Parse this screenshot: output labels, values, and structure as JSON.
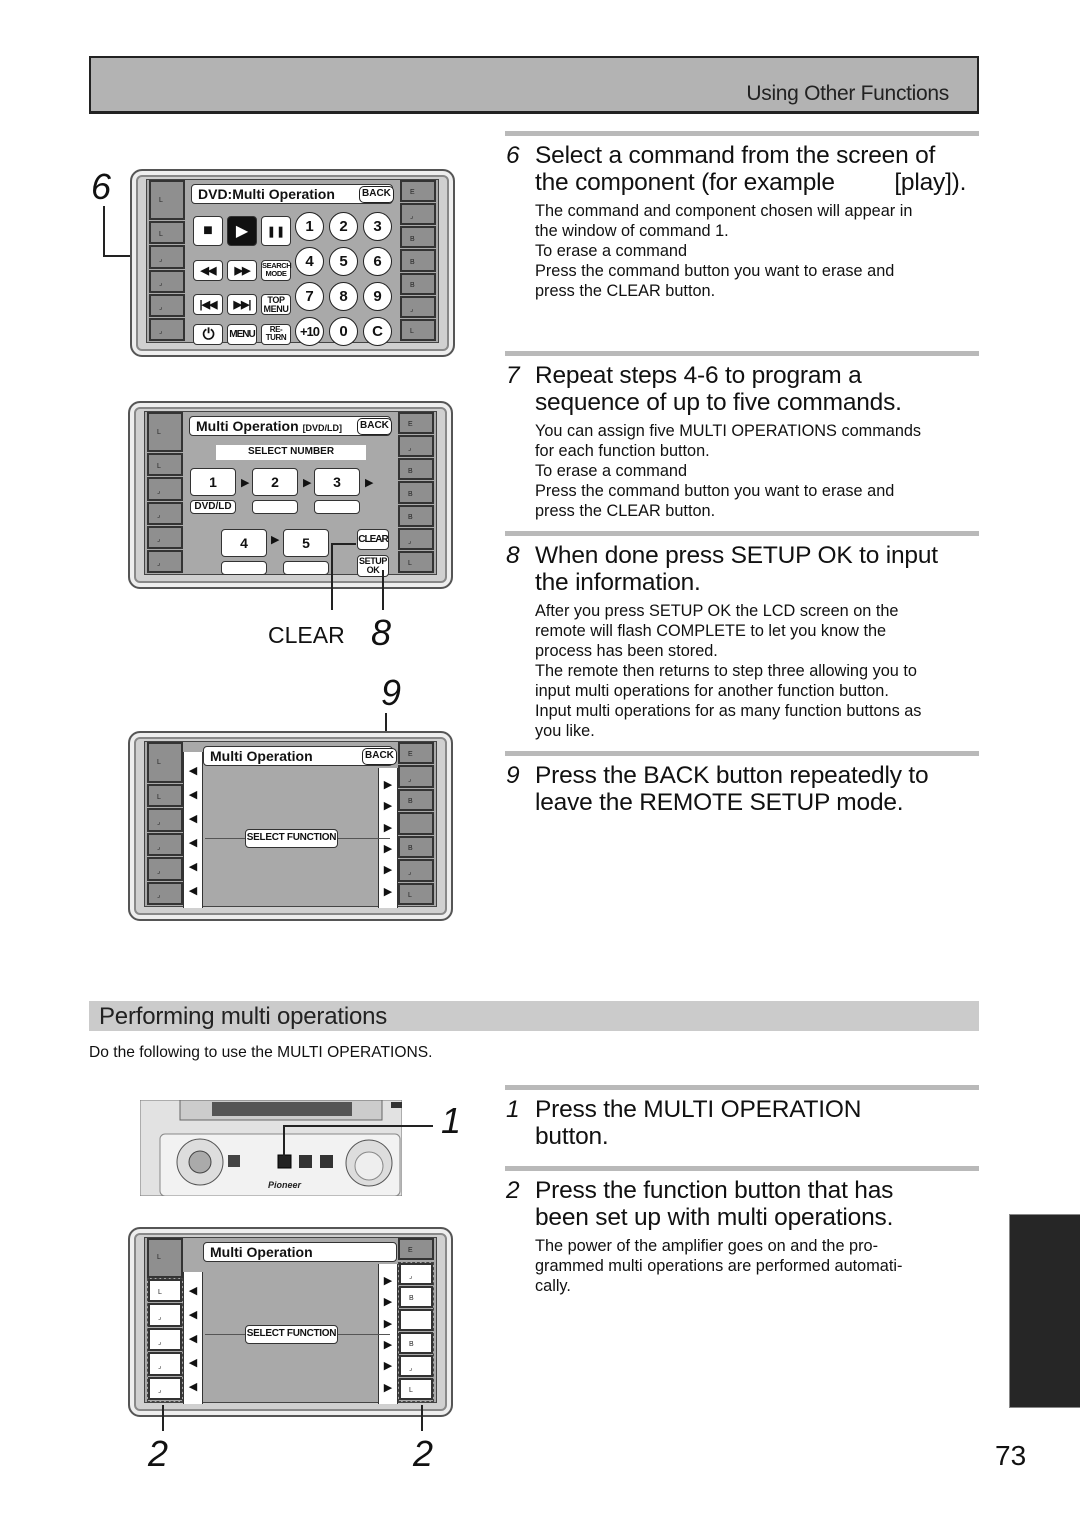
{
  "header": {
    "title": "Using Other Functions"
  },
  "steps_top": [
    {
      "number": "6",
      "title": "Select a command from  the screen of the component (for example        [play]).",
      "title_lines": [
        "Select a command from  the screen of",
        "the component (for example         [play])."
      ],
      "body": [
        "The command and component chosen will appear in",
        "the window of command 1.",
        "To erase a command",
        "Press the command button you want to erase and",
        "press the CLEAR button."
      ]
    },
    {
      "number": "7",
      "title_lines": [
        "Repeat steps 4-6 to program a",
        "sequence of up to five commands."
      ],
      "body": [
        "You can assign five MULTI OPERATIONS commands",
        "for each function button.",
        "To erase a command",
        "Press the command button you want to erase and",
        "press the CLEAR button."
      ]
    },
    {
      "number": "8",
      "title_lines": [
        "When done press SETUP OK to input",
        "the information."
      ],
      "body": [
        "After you press SETUP OK the LCD screen on the",
        "remote will flash COMPLETE to let you know the",
        "process has been stored.",
        "The remote then returns to step three allowing you to",
        "input multi operations for another function button.",
        "Input multi operations for as many function buttons as",
        "you like."
      ]
    },
    {
      "number": "9",
      "title_lines": [
        "Press the BACK button repeatedly to",
        "leave the  REMOTE SETUP mode."
      ],
      "body": []
    }
  ],
  "remote1": {
    "callout": "6",
    "title": "DVD:Multi Operation",
    "back": "BACK",
    "transport": [
      {
        "icon": "stop-icon",
        "glyph": "■"
      },
      {
        "icon": "play-icon",
        "glyph": "▶",
        "selected": true
      },
      {
        "icon": "pause-icon",
        "glyph": "❚❚"
      },
      {
        "icon": "rewind-icon",
        "glyph": "◀◀"
      },
      {
        "icon": "fast-forward-icon",
        "glyph": "▶▶"
      },
      {
        "icon": "skip-back-icon",
        "glyph": "|◀◀"
      },
      {
        "icon": "skip-forward-icon",
        "glyph": "▶▶|"
      },
      {
        "icon": "power-icon",
        "glyph": "⏻"
      }
    ],
    "search_mode": [
      "SEARCH",
      "MODE"
    ],
    "top_menu": [
      "TOP",
      "MENU"
    ],
    "menu": "MENU",
    "return": [
      "RE-",
      "TURN"
    ],
    "keypad": [
      "1",
      "2",
      "3",
      "4",
      "5",
      "6",
      "7",
      "8",
      "9",
      "+10",
      "0",
      "C"
    ]
  },
  "remote2": {
    "title": "Multi Operation",
    "subtitle": "[DVD/LD]",
    "back": "BACK",
    "select_number": "SELECT NUMBER",
    "sequence": [
      "1",
      "2",
      "3",
      "4",
      "5"
    ],
    "slot1_label": "DVD/LD",
    "clear": "CLEAR",
    "setup_ok": [
      "SETUP",
      "OK"
    ],
    "callout_clear_label": "CLEAR",
    "callout_clear_num": "8"
  },
  "remote3": {
    "callout": "9",
    "title": "Multi Operation",
    "back": "BACK",
    "select_function": "SELECT FUNCTION"
  },
  "section": {
    "title": "Performing multi operations",
    "intro": "Do the following to use the MULTI OPERATIONS."
  },
  "steps_bottom": [
    {
      "number": "1",
      "title_lines": [
        "Press the MULTI OPERATION",
        "button."
      ],
      "body": []
    },
    {
      "number": "2",
      "title_lines": [
        "Press the function button that has",
        "been set up with multi operations."
      ],
      "body": [
        "The power of the amplifier goes on and the pro-",
        "grammed multi operations are performed automati-",
        "cally."
      ]
    }
  ],
  "device": {
    "brand": "Pioneer",
    "callout": "1"
  },
  "remote4": {
    "title": "Multi Operation",
    "select_function": "SELECT FUNCTION",
    "callout_left": "2",
    "callout_right": "2"
  },
  "page_number": "73"
}
